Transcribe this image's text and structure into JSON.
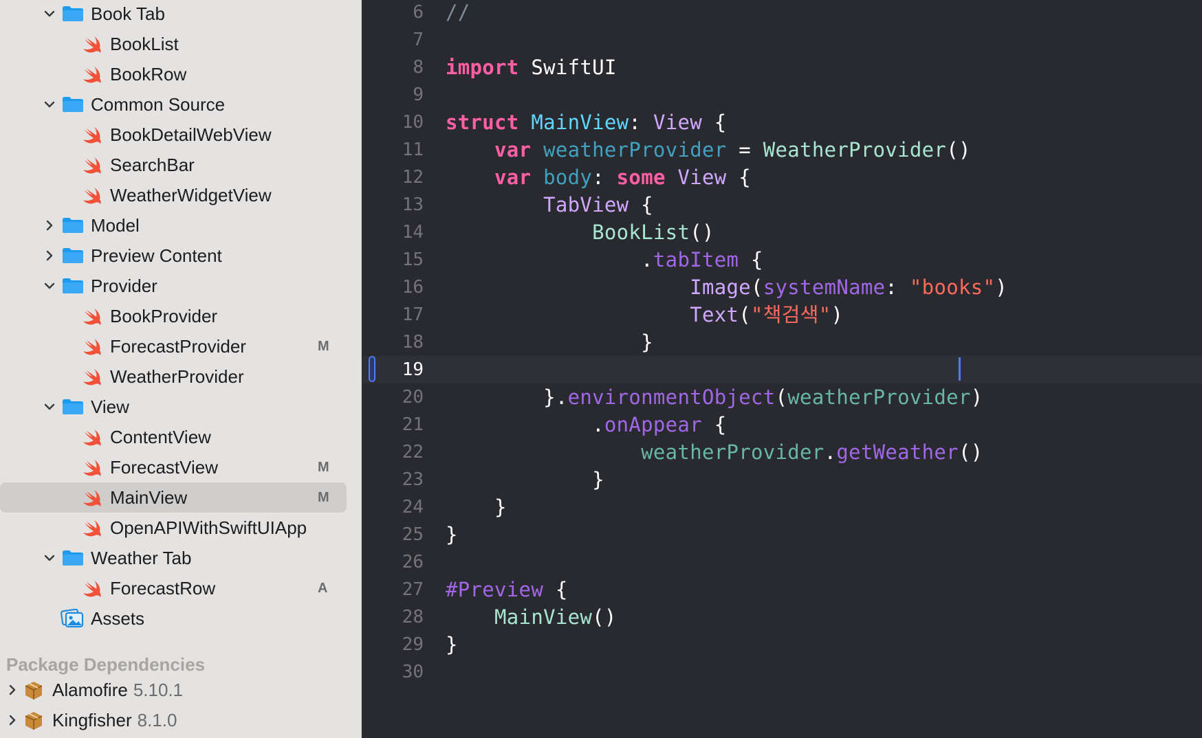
{
  "navigator": {
    "items": [
      {
        "label": "Book Tab",
        "kind": "folder",
        "expanded": true,
        "badge": ""
      },
      {
        "label": "BookList",
        "kind": "swift",
        "badge": ""
      },
      {
        "label": "BookRow",
        "kind": "swift",
        "badge": ""
      },
      {
        "label": "Common Source",
        "kind": "folder",
        "expanded": true,
        "badge": ""
      },
      {
        "label": "BookDetailWebView",
        "kind": "swift",
        "badge": ""
      },
      {
        "label": "SearchBar",
        "kind": "swift",
        "badge": ""
      },
      {
        "label": "WeatherWidgetView",
        "kind": "swift",
        "badge": ""
      },
      {
        "label": "Model",
        "kind": "folder",
        "expanded": false,
        "badge": ""
      },
      {
        "label": "Preview Content",
        "kind": "folder",
        "expanded": false,
        "badge": ""
      },
      {
        "label": "Provider",
        "kind": "folder",
        "expanded": true,
        "badge": ""
      },
      {
        "label": "BookProvider",
        "kind": "swift",
        "badge": ""
      },
      {
        "label": "ForecastProvider",
        "kind": "swift",
        "badge": "M"
      },
      {
        "label": "WeatherProvider",
        "kind": "swift",
        "badge": ""
      },
      {
        "label": "View",
        "kind": "folder",
        "expanded": true,
        "badge": ""
      },
      {
        "label": "ContentView",
        "kind": "swift",
        "badge": ""
      },
      {
        "label": "ForecastView",
        "kind": "swift",
        "badge": "M"
      },
      {
        "label": "MainView",
        "kind": "swift",
        "badge": "M",
        "selected": true
      },
      {
        "label": "OpenAPIWithSwiftUIApp",
        "kind": "swift",
        "badge": ""
      },
      {
        "label": "Weather Tab",
        "kind": "folder",
        "expanded": true,
        "badge": ""
      },
      {
        "label": "ForecastRow",
        "kind": "swift",
        "badge": "A"
      },
      {
        "label": "Assets",
        "kind": "assets",
        "badge": ""
      }
    ],
    "section_header": "Package Dependencies",
    "packages": [
      {
        "name": "Alamofire",
        "version": "5.10.1"
      },
      {
        "name": "Kingfisher",
        "version": "8.1.0"
      }
    ]
  },
  "editor": {
    "current_line": 19,
    "lines": [
      {
        "n": "6",
        "text": "//"
      },
      {
        "n": "7",
        "text": ""
      },
      {
        "n": "8",
        "text": "import SwiftUI"
      },
      {
        "n": "9",
        "text": ""
      },
      {
        "n": "10",
        "text": "struct MainView: View {"
      },
      {
        "n": "11",
        "text": "    var weatherProvider = WeatherProvider()"
      },
      {
        "n": "12",
        "text": "    var body: some View {"
      },
      {
        "n": "13",
        "text": "        TabView {"
      },
      {
        "n": "14",
        "text": "            BookList()"
      },
      {
        "n": "15",
        "text": "                .tabItem {"
      },
      {
        "n": "16",
        "text": "                    Image(systemName: \"books\")"
      },
      {
        "n": "17",
        "text": "                    Text(\"책검색\")"
      },
      {
        "n": "18",
        "text": "                }"
      },
      {
        "n": "19",
        "text": ""
      },
      {
        "n": "20",
        "text": "        }.environmentObject(weatherProvider)"
      },
      {
        "n": "21",
        "text": "            .onAppear {"
      },
      {
        "n": "22",
        "text": "                weatherProvider.getWeather()"
      },
      {
        "n": "23",
        "text": "            }"
      },
      {
        "n": "24",
        "text": "    }"
      },
      {
        "n": "25",
        "text": "}"
      },
      {
        "n": "26",
        "text": ""
      },
      {
        "n": "27",
        "text": "#Preview {"
      },
      {
        "n": "28",
        "text": "    MainView()"
      },
      {
        "n": "29",
        "text": "}"
      },
      {
        "n": "30",
        "text": ""
      }
    ]
  },
  "colors": {
    "sidebar_bg": "#e4e3e2",
    "editor_bg": "#292a30",
    "keyword": "#fc5fa3",
    "string": "#fc6a5d",
    "type": "#d0a8ff",
    "declared_type": "#5dd8ff",
    "caret": "#4f7ef2",
    "folder": "#1c9bf0",
    "swift": "#f05138"
  }
}
